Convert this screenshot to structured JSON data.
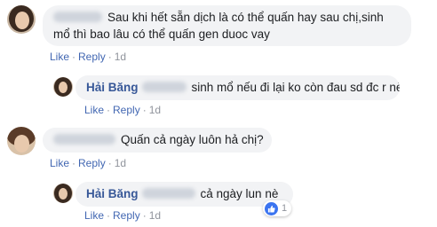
{
  "comments": [
    {
      "text": "Sau khi hết sẵn dịch là có thể quấn hay sau chị,sinh mổ thì bao lâu có thể quấn gen duoc vay",
      "actions": {
        "like": "Like",
        "reply": "Reply",
        "time": "1d"
      }
    },
    {
      "author": "Hải Băng",
      "text": "sinh mổ nếu đi lại ko còn đau sd đc r nè...",
      "actions": {
        "like": "Like",
        "reply": "Reply",
        "time": "1d"
      }
    },
    {
      "text": "Quấn cả ngày luôn hả chị?",
      "actions": {
        "like": "Like",
        "reply": "Reply",
        "time": "1d"
      }
    },
    {
      "author": "Hải Băng",
      "text": "cả ngày lun nè",
      "actions": {
        "like": "Like",
        "reply": "Reply",
        "time": "1d"
      },
      "reaction": {
        "icon": "like-icon",
        "count": "1",
        "color": "#3b74f0"
      }
    }
  ],
  "colors": {
    "bubble": "#f2f3f5",
    "link": "#4267b2",
    "author": "#385898",
    "meta": "#90949c"
  }
}
